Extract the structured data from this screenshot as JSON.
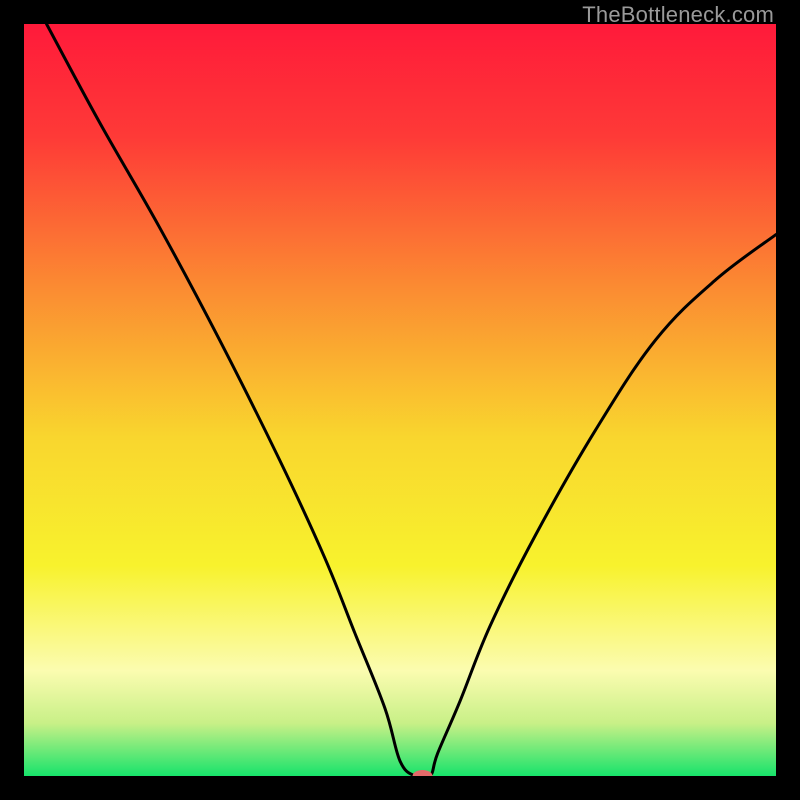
{
  "watermark": "TheBottleneck.com",
  "chart_data": {
    "type": "line",
    "title": "",
    "xlabel": "",
    "ylabel": "",
    "xlim": [
      0,
      100
    ],
    "ylim": [
      0,
      100
    ],
    "grid": false,
    "background_gradient": {
      "stops": [
        {
          "offset": 0.0,
          "color": "#ff1a3a"
        },
        {
          "offset": 0.15,
          "color": "#fe3a37"
        },
        {
          "offset": 0.35,
          "color": "#fb8b32"
        },
        {
          "offset": 0.55,
          "color": "#f9d62e"
        },
        {
          "offset": 0.72,
          "color": "#f8f22d"
        },
        {
          "offset": 0.86,
          "color": "#fbfcb0"
        },
        {
          "offset": 0.93,
          "color": "#c8f087"
        },
        {
          "offset": 1.0,
          "color": "#17e36b"
        }
      ]
    },
    "series": [
      {
        "name": "bottleneck-curve",
        "color": "#000000",
        "x": [
          3,
          10,
          18,
          26,
          34,
          40,
          44,
          48,
          50,
          52,
          54,
          55,
          58,
          62,
          68,
          76,
          84,
          92,
          100
        ],
        "y": [
          100,
          87,
          73,
          58,
          42,
          29,
          19,
          9,
          2,
          0,
          0,
          3,
          10,
          20,
          32,
          46,
          58,
          66,
          72
        ]
      }
    ],
    "marker": {
      "name": "minimum-marker",
      "x": 53,
      "y": 0,
      "color": "#e46a6a",
      "rx": 10,
      "ry": 6
    }
  }
}
